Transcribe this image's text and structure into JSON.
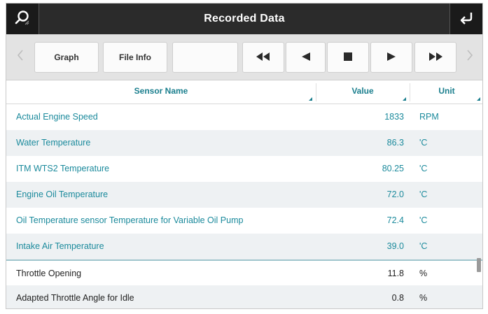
{
  "titlebar": {
    "title": "Recorded Data",
    "left_icon": "search-icon",
    "right_icon": "return-icon"
  },
  "toolbar": {
    "prev_icon": "chevron-left-icon",
    "graph_label": "Graph",
    "file_info_label": "File Info",
    "blank_label": "",
    "rewind_icon": "rewind-icon",
    "play_back_icon": "play-reverse-icon",
    "stop_icon": "stop-icon",
    "play_icon": "play-icon",
    "fast_forward_icon": "fast-forward-icon",
    "next_icon": "chevron-right-icon"
  },
  "table": {
    "columns": {
      "name": "Sensor Name",
      "value": "Value",
      "unit": "Unit"
    },
    "rows": [
      {
        "name": "Actual Engine Speed",
        "value": "1833",
        "unit": "RPM"
      },
      {
        "name": "Water Temperature",
        "value": "86.3",
        "unit": "'C"
      },
      {
        "name": "ITM WTS2 Temperature",
        "value": "80.25",
        "unit": "'C"
      },
      {
        "name": "Engine Oil Temperature",
        "value": "72.0",
        "unit": "'C"
      },
      {
        "name": "Oil Temperature sensor Temperature for Variable Oil Pump",
        "value": "72.4",
        "unit": "'C"
      },
      {
        "name": "Intake Air Temperature",
        "value": "39.0",
        "unit": "'C"
      },
      {
        "name": "Throttle Opening",
        "value": "11.8",
        "unit": "%"
      },
      {
        "name": "Adapted Throttle Angle for Idle",
        "value": "0.8",
        "unit": "%"
      }
    ]
  },
  "colors": {
    "accent": "#1b8a9c",
    "titlebar": "#2b2b2b"
  }
}
